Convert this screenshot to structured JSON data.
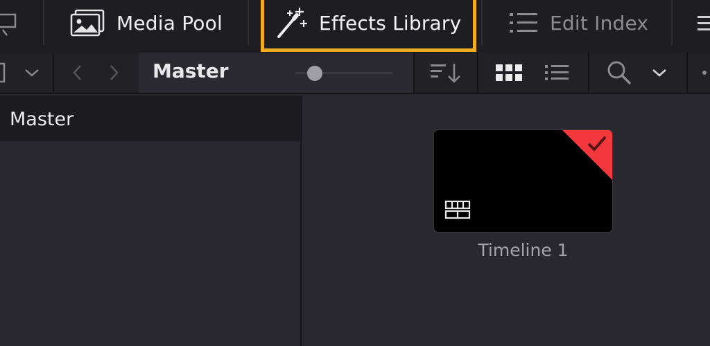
{
  "top_tabs": {
    "media_pool": {
      "label": "Media Pool",
      "icon": "media-pool-icon"
    },
    "effects_library": {
      "label": "Effects Library",
      "icon": "magic-wand-icon",
      "active": true
    },
    "edit_index": {
      "label": "Edit Index",
      "icon": "edit-index-icon"
    }
  },
  "toolbar": {
    "breadcrumb": "Master",
    "icons": [
      "chevron-down-icon",
      "back-arrow-icon",
      "forward-arrow-icon",
      "sort-icon",
      "grid-view-icon",
      "list-view-icon",
      "search-icon",
      "chevron-down-icon"
    ]
  },
  "bins": [
    {
      "label": "Master",
      "selected": true
    }
  ],
  "clips": [
    {
      "name": "Timeline 1",
      "type": "timeline",
      "flag_color": "#f2383c"
    }
  ],
  "colors": {
    "highlight": "#f3ad1e",
    "flag": "#f2383c"
  }
}
